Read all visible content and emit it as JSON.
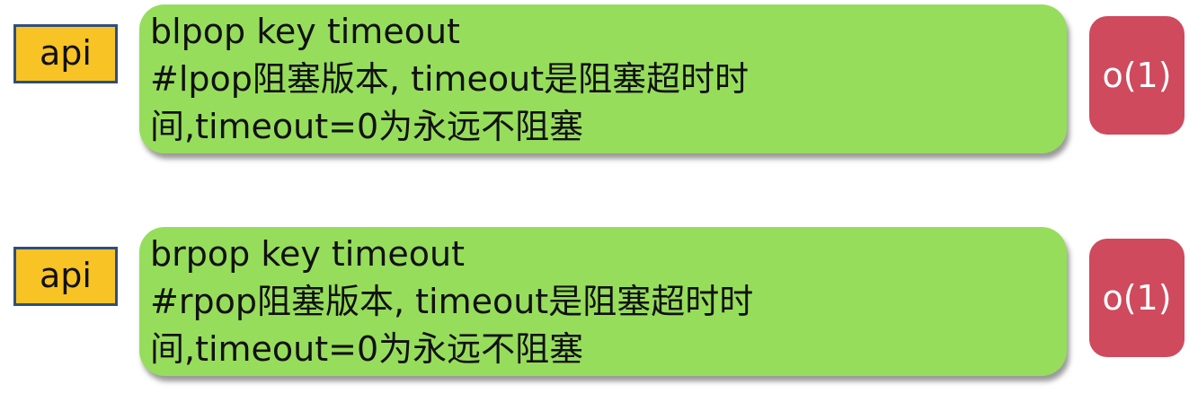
{
  "rows": [
    {
      "tag": "api",
      "command": "blpop key timeout",
      "description_line1": "#lpop阻塞版本, timeout是阻塞超时时",
      "description_line2": "间,timeout=0为永远不阻塞",
      "complexity": "o(1)"
    },
    {
      "tag": "api",
      "command": "brpop key timeout",
      "description_line1": "#rpop阻塞版本, timeout是阻塞超时时",
      "description_line2": "间,timeout=0为永远不阻塞",
      "complexity": "o(1)"
    }
  ],
  "colors": {
    "api_badge_fill": "#f7c325",
    "api_badge_border": "#2f4f7a",
    "command_box": "#97dd5c",
    "complexity_badge": "#cf4a5d"
  }
}
